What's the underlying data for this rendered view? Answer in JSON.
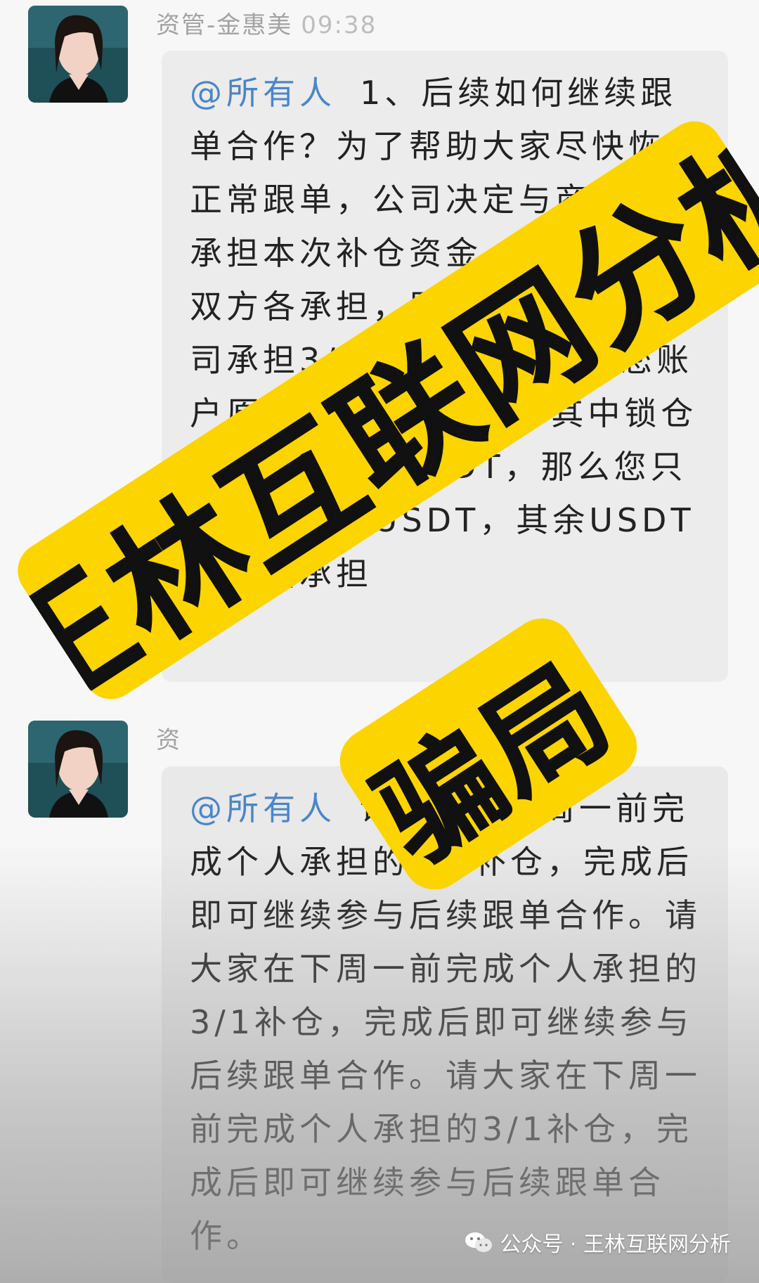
{
  "message_1": {
    "sender": "资管-金惠美",
    "time": "09:38",
    "mention": "@所有人",
    "text": "1、后续如何继续跟单合作？为了帮助大家尽快恢复正常跟单，公司决定与商户共同承担本次补仓资金。补仓金额由双方各承担，即您承担3/1，公司承担3/2。举个例子如果您账户原本余额为USDT，其中锁仓金额为1068USDT，那么您只需补仓356USDT，其余USDT由集团承担"
  },
  "message_2": {
    "sender": "资",
    "mention": "@所有人",
    "text": "请大家在下周一前完成个人承担的3/1补仓，完成后即可继续参与后续跟单合作。请大家在下周一前完成个人承担的3/1补仓，完成后即可继续参与后续跟单合作。请大家在下周一前完成个人承担的3/1补仓，完成后即可继续参与后续跟单合作。"
  },
  "overlay": {
    "line_1": "王林互联网分析",
    "line_2": "骗局",
    "color": "#fcd400"
  },
  "watermark": {
    "text": "公众号 · 王林互联网分析"
  },
  "colors": {
    "mention": "#4a86c8",
    "bubble": "#ececec",
    "background": "#f7f7f7"
  }
}
